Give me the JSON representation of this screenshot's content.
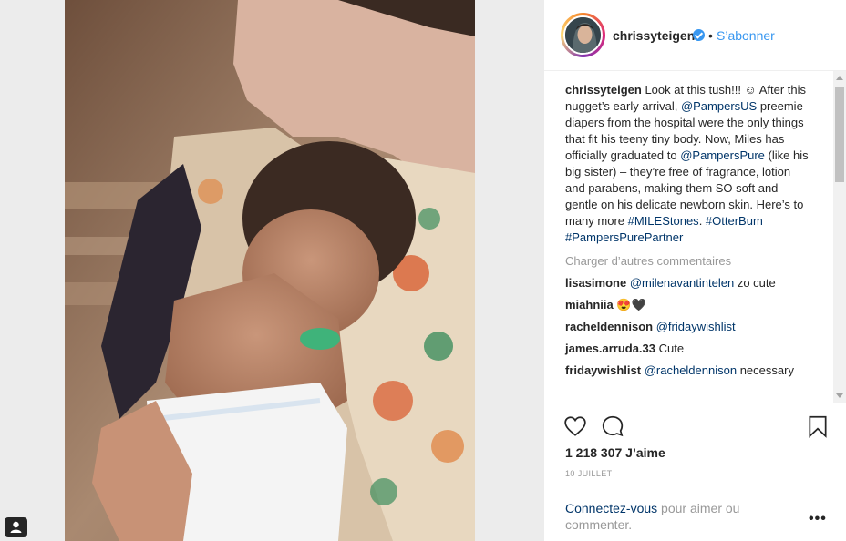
{
  "post": {
    "username": "chrissyteigen",
    "separator": "•",
    "follow_label": "S’abonner",
    "verified_icon": "verified-badge-icon"
  },
  "caption": {
    "username": "chrissyteigen",
    "part1": " Look at this tush!!! ☺ After this nugget’s early arrival, ",
    "mention1": "@PampersUS",
    "part2": " preemie diapers from the hospital were the only things that fit his teeny tiny body. Now, Miles has officially graduated to ",
    "mention2": "@PampersPure",
    "part3": " (like his big sister) – they’re free of fragrance, lotion and parabens, making them SO soft and gentle on his delicate newborn skin. Here’s to many more ",
    "hashtag1": "#MILEStones",
    "part4": ". ",
    "hashtag2": "#OtterBum",
    "part5": " ",
    "hashtag3": "#PampersPurePartner"
  },
  "load_more": "Charger d’autres commentaires",
  "comments": [
    {
      "user": "lisasimone",
      "mention": "@milenavantintelen",
      "text": " zo cute"
    },
    {
      "user": "miahniia",
      "mention": "",
      "text": " 😍🖤"
    },
    {
      "user": "racheldennison",
      "mention": "@fridaywishlist",
      "text": ""
    },
    {
      "user": "james.arruda.33",
      "mention": "",
      "text": " Cute"
    },
    {
      "user": "fridaywishlist",
      "mention": "@racheldennison",
      "text": " necessary"
    }
  ],
  "actions": {
    "likes": "1 218 307 J’aime",
    "date": "10 JUILLET",
    "icons": [
      "heart-icon",
      "comment-icon",
      "bookmark-icon"
    ]
  },
  "footer": {
    "login_link": "Connectez-vous",
    "login_text": " pour aimer ou commenter.",
    "options": "•••"
  },
  "colors": {
    "link": "#003569",
    "follow": "#3897f0",
    "muted": "#999999",
    "background": "#ececec"
  }
}
